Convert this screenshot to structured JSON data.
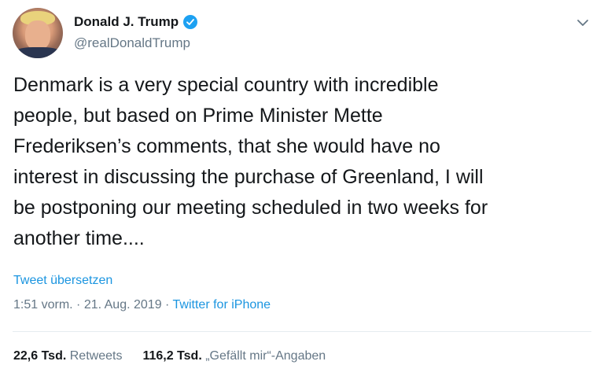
{
  "author": {
    "display_name": "Donald J. Trump",
    "handle": "@realDonaldTrump",
    "verified": true,
    "avatar_icon": "profile-photo"
  },
  "tweet": {
    "lines": [
      "Denmark is a very special country with incredible",
      "people, but based on Prime Minister Mette",
      "Frederiksen’s comments, that she would have no",
      "interest in discussing the purchase of Greenland, I will",
      "be postponing our meeting scheduled in two weeks for",
      "another time...."
    ],
    "translate_label": "Tweet übersetzen",
    "time": "1:51 vorm.",
    "date": "21. Aug. 2019",
    "source": "Twitter for iPhone"
  },
  "stats": {
    "retweets_count": "22,6 Tsd.",
    "retweets_label": "Retweets",
    "likes_count": "116,2 Tsd.",
    "likes_label": "„Gefällt mir“-Angaben"
  },
  "colors": {
    "text": "#14171a",
    "secondary": "#657786",
    "link": "#1b95e0",
    "verified": "#1da1f2"
  }
}
